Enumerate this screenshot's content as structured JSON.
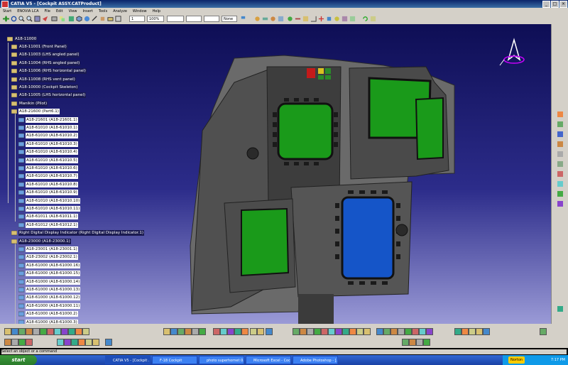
{
  "window": {
    "title": "CATIA V5 - [Cockpit ASSY.CATProduct]",
    "min": "_",
    "max": "□",
    "close": "×"
  },
  "menu": [
    "Start",
    "ENOVIA LCA",
    "File",
    "Edit",
    "View",
    "Insert",
    "Tools",
    "Analyze",
    "Window",
    "Help"
  ],
  "toolbar": {
    "line_width": "1",
    "zoom": "100%",
    "layer": "None"
  },
  "tree": {
    "root": "A18-11000",
    "items": [
      {
        "label": "A18-11001 (Front Panel)",
        "level": 1,
        "sel": false
      },
      {
        "label": "A18-11003 (LHS angled panel)",
        "level": 1,
        "sel": false
      },
      {
        "label": "A18-11004 (RHS angled panel)",
        "level": 1,
        "sel": false
      },
      {
        "label": "A18-11006 (RHS horizontal panel)",
        "level": 1,
        "sel": false
      },
      {
        "label": "A18-11008 (RHS vent panel)",
        "level": 1,
        "sel": false
      },
      {
        "label": "A18-10000 (Cockpit Skeleton)",
        "level": 1,
        "sel": false
      },
      {
        "label": "A18-11005 (LHS horizontal panel)",
        "level": 1,
        "sel": false
      },
      {
        "label": "Manikin (Pilot)",
        "level": 1,
        "sel": false
      },
      {
        "label": "A18-21600 (Part6.1)",
        "level": 1,
        "sel": true
      },
      {
        "label": "A18-21601 (A18-21601.1)",
        "level": 2,
        "sel": true
      },
      {
        "label": "A18-61010 (A18-61010.1)",
        "level": 2,
        "sel": true
      },
      {
        "label": "A18-61010 (A18-61010.2)",
        "level": 2,
        "sel": true
      },
      {
        "label": "A18-61010 (A18-61010.3)",
        "level": 2,
        "sel": true
      },
      {
        "label": "A18-61010 (A18-61010.4)",
        "level": 2,
        "sel": true
      },
      {
        "label": "A18-61010 (A18-61010.5)",
        "level": 2,
        "sel": true
      },
      {
        "label": "A18-61010 (A18-61010.6)",
        "level": 2,
        "sel": true
      },
      {
        "label": "A18-61010 (A18-61010.7)",
        "level": 2,
        "sel": true
      },
      {
        "label": "A18-61010 (A18-61010.8)",
        "level": 2,
        "sel": true
      },
      {
        "label": "A18-61010 (A18-61010.9)",
        "level": 2,
        "sel": true
      },
      {
        "label": "A18-61010 (A18-61010.10)",
        "level": 2,
        "sel": true
      },
      {
        "label": "A18-61010 (A18-61010.11)",
        "level": 2,
        "sel": true
      },
      {
        "label": "A18-61011 (A18-61011.1)",
        "level": 2,
        "sel": true
      },
      {
        "label": "A18-61012 (A18-61012.1)",
        "level": 2,
        "sel": true
      },
      {
        "label": "Right Digital Display Indicator (Right Digital Display Indicator.1)",
        "level": 1,
        "sel": false
      },
      {
        "label": "A18-23000 (A18-23000.1)",
        "level": 1,
        "sel": false
      },
      {
        "label": "A18-23001 (A18-23001.1)",
        "level": 2,
        "sel": true
      },
      {
        "label": "A18-23002 (A18-23002.1)",
        "level": 2,
        "sel": true
      },
      {
        "label": "A18-61000 (A18-61000.16)",
        "level": 2,
        "sel": true
      },
      {
        "label": "A18-61000 (A18-61000.15)",
        "level": 2,
        "sel": true
      },
      {
        "label": "A18-61000 (A18-61000.14)",
        "level": 2,
        "sel": true
      },
      {
        "label": "A18-61000 (A18-61000.13)",
        "level": 2,
        "sel": true
      },
      {
        "label": "A18-61000 (A18-61000.12)",
        "level": 2,
        "sel": true
      },
      {
        "label": "A18-61000 (A18-61000.11)",
        "level": 2,
        "sel": true
      },
      {
        "label": "A18-61000 (A18-61000.2)",
        "level": 2,
        "sel": true
      },
      {
        "label": "A18-61000 (A18-61000.3)",
        "level": 2,
        "sel": true
      }
    ]
  },
  "status": "Select an object or a command",
  "taskbar": {
    "start": "start",
    "tasks": [
      "CATIA V5 - [Cockpit ...",
      "F-18 Cockpit",
      "photo superhornet 0...",
      "Microsoft Excel - Coc...",
      "Adobe Photoshop - [..."
    ],
    "norton": "Norton",
    "clock": "7:17 PM"
  }
}
